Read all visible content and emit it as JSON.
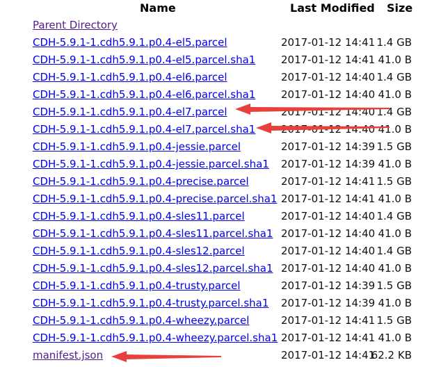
{
  "headers": {
    "name": "Name",
    "modified": "Last Modified",
    "size": "Size"
  },
  "rows": [
    {
      "name": "Parent Directory",
      "date": "",
      "size": "",
      "visited": true
    },
    {
      "name": "CDH-5.9.1-1.cdh5.9.1.p0.4-el5.parcel",
      "date": "2017-01-12 14:41",
      "size": "1.4 GB"
    },
    {
      "name": "CDH-5.9.1-1.cdh5.9.1.p0.4-el5.parcel.sha1",
      "date": "2017-01-12 14:41",
      "size": "41.0 B"
    },
    {
      "name": "CDH-5.9.1-1.cdh5.9.1.p0.4-el6.parcel",
      "date": "2017-01-12 14:40",
      "size": "1.4 GB"
    },
    {
      "name": "CDH-5.9.1-1.cdh5.9.1.p0.4-el6.parcel.sha1",
      "date": "2017-01-12 14:40",
      "size": "41.0 B"
    },
    {
      "name": "CDH-5.9.1-1.cdh5.9.1.p0.4-el7.parcel",
      "date": "2017-01-12 14:40",
      "size": "1.4 GB"
    },
    {
      "name": "CDH-5.9.1-1.cdh5.9.1.p0.4-el7.parcel.sha1",
      "date": "2017-01-12 14:40",
      "size": "41.0 B"
    },
    {
      "name": "CDH-5.9.1-1.cdh5.9.1.p0.4-jessie.parcel",
      "date": "2017-01-12 14:39",
      "size": "1.5 GB"
    },
    {
      "name": "CDH-5.9.1-1.cdh5.9.1.p0.4-jessie.parcel.sha1",
      "date": "2017-01-12 14:39",
      "size": "41.0 B"
    },
    {
      "name": "CDH-5.9.1-1.cdh5.9.1.p0.4-precise.parcel",
      "date": "2017-01-12 14:41",
      "size": "1.5 GB"
    },
    {
      "name": "CDH-5.9.1-1.cdh5.9.1.p0.4-precise.parcel.sha1",
      "date": "2017-01-12 14:41",
      "size": "41.0 B"
    },
    {
      "name": "CDH-5.9.1-1.cdh5.9.1.p0.4-sles11.parcel",
      "date": "2017-01-12 14:40",
      "size": "1.4 GB"
    },
    {
      "name": "CDH-5.9.1-1.cdh5.9.1.p0.4-sles11.parcel.sha1",
      "date": "2017-01-12 14:40",
      "size": "41.0 B"
    },
    {
      "name": "CDH-5.9.1-1.cdh5.9.1.p0.4-sles12.parcel",
      "date": "2017-01-12 14:40",
      "size": "1.4 GB"
    },
    {
      "name": "CDH-5.9.1-1.cdh5.9.1.p0.4-sles12.parcel.sha1",
      "date": "2017-01-12 14:40",
      "size": "41.0 B"
    },
    {
      "name": "CDH-5.9.1-1.cdh5.9.1.p0.4-trusty.parcel",
      "date": "2017-01-12 14:39",
      "size": "1.5 GB"
    },
    {
      "name": "CDH-5.9.1-1.cdh5.9.1.p0.4-trusty.parcel.sha1",
      "date": "2017-01-12 14:39",
      "size": "41.0 B"
    },
    {
      "name": "CDH-5.9.1-1.cdh5.9.1.p0.4-wheezy.parcel",
      "date": "2017-01-12 14:41",
      "size": "1.5 GB"
    },
    {
      "name": "CDH-5.9.1-1.cdh5.9.1.p0.4-wheezy.parcel.sha1",
      "date": "2017-01-12 14:41",
      "size": "41.0 B"
    },
    {
      "name": "manifest.json",
      "date": "2017-01-12 14:41",
      "size": "62.2 KB",
      "visited": true
    }
  ],
  "annotation_color": "#e8413c"
}
